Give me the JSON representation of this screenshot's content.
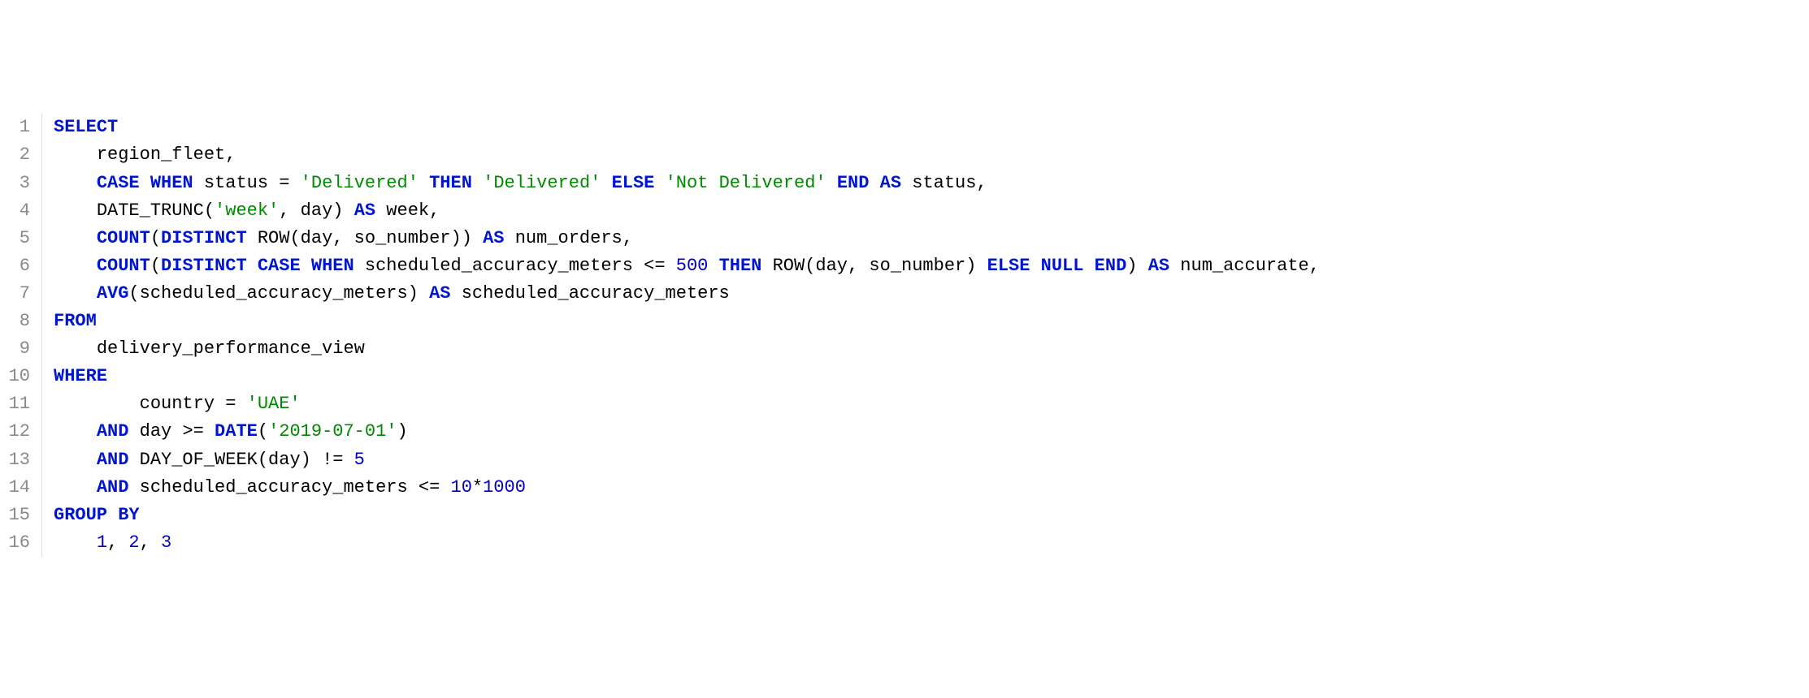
{
  "lines": [
    {
      "num": "1",
      "indent": "",
      "tokens": [
        {
          "cls": "kw",
          "t": "SELECT"
        }
      ]
    },
    {
      "num": "2",
      "indent": "    ",
      "tokens": [
        {
          "cls": "id",
          "t": "region_fleet,"
        }
      ]
    },
    {
      "num": "3",
      "indent": "    ",
      "tokens": [
        {
          "cls": "kw",
          "t": "CASE"
        },
        {
          "cls": "id",
          "t": " "
        },
        {
          "cls": "kw",
          "t": "WHEN"
        },
        {
          "cls": "id",
          "t": " status "
        },
        {
          "cls": "op",
          "t": "="
        },
        {
          "cls": "id",
          "t": " "
        },
        {
          "cls": "str",
          "t": "'Delivered'"
        },
        {
          "cls": "id",
          "t": " "
        },
        {
          "cls": "kw",
          "t": "THEN"
        },
        {
          "cls": "id",
          "t": " "
        },
        {
          "cls": "str",
          "t": "'Delivered'"
        },
        {
          "cls": "id",
          "t": " "
        },
        {
          "cls": "kw",
          "t": "ELSE"
        },
        {
          "cls": "id",
          "t": " "
        },
        {
          "cls": "str",
          "t": "'Not Delivered'"
        },
        {
          "cls": "id",
          "t": " "
        },
        {
          "cls": "kw",
          "t": "END"
        },
        {
          "cls": "id",
          "t": " "
        },
        {
          "cls": "kw",
          "t": "AS"
        },
        {
          "cls": "id",
          "t": " status,"
        }
      ]
    },
    {
      "num": "4",
      "indent": "    ",
      "tokens": [
        {
          "cls": "id",
          "t": "DATE_TRUNC("
        },
        {
          "cls": "str",
          "t": "'week'"
        },
        {
          "cls": "id",
          "t": ", day) "
        },
        {
          "cls": "kw",
          "t": "AS"
        },
        {
          "cls": "id",
          "t": " week,"
        }
      ]
    },
    {
      "num": "5",
      "indent": "    ",
      "tokens": [
        {
          "cls": "fn",
          "t": "COUNT"
        },
        {
          "cls": "id",
          "t": "("
        },
        {
          "cls": "kw",
          "t": "DISTINCT"
        },
        {
          "cls": "id",
          "t": " ROW(day, so_number)) "
        },
        {
          "cls": "kw",
          "t": "AS"
        },
        {
          "cls": "id",
          "t": " num_orders,"
        }
      ]
    },
    {
      "num": "6",
      "indent": "    ",
      "tokens": [
        {
          "cls": "fn",
          "t": "COUNT"
        },
        {
          "cls": "id",
          "t": "("
        },
        {
          "cls": "kw",
          "t": "DISTINCT"
        },
        {
          "cls": "id",
          "t": " "
        },
        {
          "cls": "kw",
          "t": "CASE"
        },
        {
          "cls": "id",
          "t": " "
        },
        {
          "cls": "kw",
          "t": "WHEN"
        },
        {
          "cls": "id",
          "t": " scheduled_accuracy_meters "
        },
        {
          "cls": "op",
          "t": "<="
        },
        {
          "cls": "id",
          "t": " "
        },
        {
          "cls": "num",
          "t": "500"
        },
        {
          "cls": "id",
          "t": " "
        },
        {
          "cls": "kw",
          "t": "THEN"
        },
        {
          "cls": "id",
          "t": " ROW(day, so_number) "
        },
        {
          "cls": "kw",
          "t": "ELSE"
        },
        {
          "cls": "id",
          "t": " "
        },
        {
          "cls": "kw",
          "t": "NULL"
        },
        {
          "cls": "id",
          "t": " "
        },
        {
          "cls": "kw",
          "t": "END"
        },
        {
          "cls": "id",
          "t": ") "
        },
        {
          "cls": "kw",
          "t": "AS"
        },
        {
          "cls": "id",
          "t": " num_accurate,"
        }
      ]
    },
    {
      "num": "7",
      "indent": "    ",
      "tokens": [
        {
          "cls": "fn",
          "t": "AVG"
        },
        {
          "cls": "id",
          "t": "(scheduled_accuracy_meters) "
        },
        {
          "cls": "kw",
          "t": "AS"
        },
        {
          "cls": "id",
          "t": " scheduled_accuracy_meters"
        }
      ]
    },
    {
      "num": "8",
      "indent": "",
      "tokens": [
        {
          "cls": "kw",
          "t": "FROM"
        }
      ]
    },
    {
      "num": "9",
      "indent": "    ",
      "tokens": [
        {
          "cls": "id",
          "t": "delivery_performance_view"
        }
      ]
    },
    {
      "num": "10",
      "indent": "",
      "tokens": [
        {
          "cls": "kw",
          "t": "WHERE"
        }
      ]
    },
    {
      "num": "11",
      "indent": "        ",
      "tokens": [
        {
          "cls": "id",
          "t": "country "
        },
        {
          "cls": "op",
          "t": "="
        },
        {
          "cls": "id",
          "t": " "
        },
        {
          "cls": "str",
          "t": "'UAE'"
        }
      ]
    },
    {
      "num": "12",
      "indent": "    ",
      "tokens": [
        {
          "cls": "kw",
          "t": "AND"
        },
        {
          "cls": "id",
          "t": " day "
        },
        {
          "cls": "op",
          "t": ">="
        },
        {
          "cls": "id",
          "t": " "
        },
        {
          "cls": "fn",
          "t": "DATE"
        },
        {
          "cls": "id",
          "t": "("
        },
        {
          "cls": "str",
          "t": "'2019-07-01'"
        },
        {
          "cls": "id",
          "t": ")"
        }
      ]
    },
    {
      "num": "13",
      "indent": "    ",
      "tokens": [
        {
          "cls": "kw",
          "t": "AND"
        },
        {
          "cls": "id",
          "t": " DAY_OF_WEEK(day) "
        },
        {
          "cls": "op",
          "t": "!="
        },
        {
          "cls": "id",
          "t": " "
        },
        {
          "cls": "num",
          "t": "5"
        }
      ]
    },
    {
      "num": "14",
      "indent": "    ",
      "tokens": [
        {
          "cls": "kw",
          "t": "AND"
        },
        {
          "cls": "id",
          "t": " scheduled_accuracy_meters "
        },
        {
          "cls": "op",
          "t": "<="
        },
        {
          "cls": "id",
          "t": " "
        },
        {
          "cls": "num",
          "t": "10"
        },
        {
          "cls": "starnum",
          "t": "*"
        },
        {
          "cls": "num",
          "t": "1000"
        }
      ]
    },
    {
      "num": "15",
      "indent": "",
      "tokens": [
        {
          "cls": "kw",
          "t": "GROUP"
        },
        {
          "cls": "id",
          "t": " "
        },
        {
          "cls": "kw",
          "t": "BY"
        }
      ]
    },
    {
      "num": "16",
      "indent": "    ",
      "tokens": [
        {
          "cls": "num",
          "t": "1"
        },
        {
          "cls": "id",
          "t": ", "
        },
        {
          "cls": "num",
          "t": "2"
        },
        {
          "cls": "id",
          "t": ", "
        },
        {
          "cls": "num",
          "t": "3"
        }
      ]
    }
  ]
}
